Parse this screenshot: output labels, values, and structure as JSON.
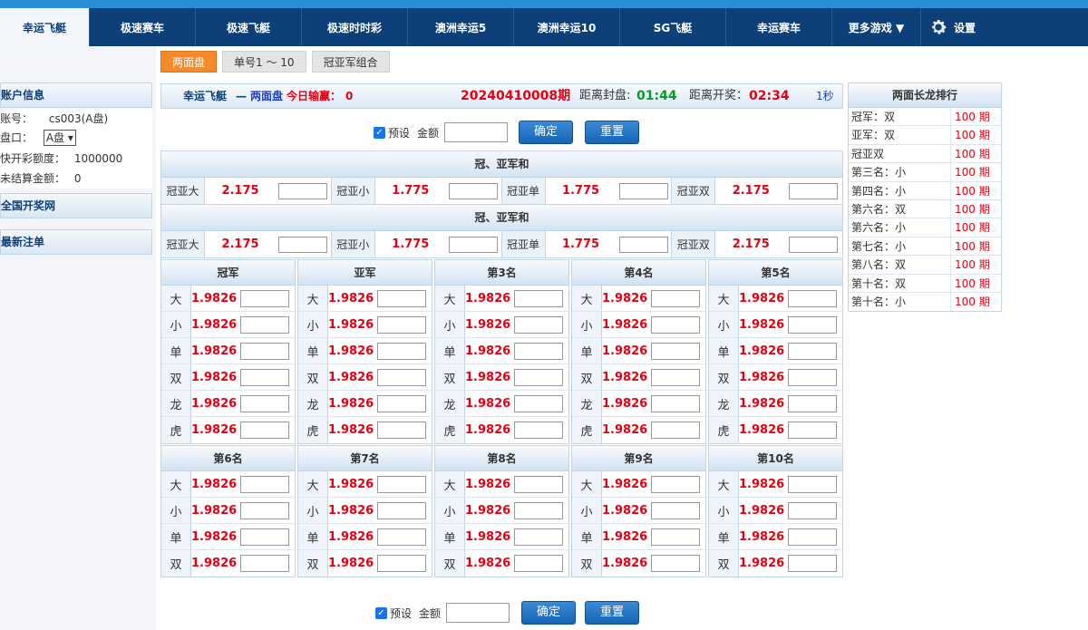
{
  "nav": {
    "items": [
      "幸运飞艇",
      "极速赛车",
      "极速飞艇",
      "极速时时彩",
      "澳洲幸运5",
      "澳洲幸运10",
      "SG飞艇",
      "幸运赛车"
    ],
    "more": "更多游戏 ▼",
    "settings": "设置"
  },
  "left": {
    "account_title": "账户信息",
    "account_label": "账号：",
    "account_value": "cs003(A盘)",
    "handicap_label": "盘口：",
    "handicap_value": "A盘",
    "quota_label": "快开彩额度：",
    "quota_value": "1000000",
    "unsettled_label": "未结算金额：",
    "unsettled_value": "0",
    "national_link": "全国开奖网",
    "latest_bets": "最新注单"
  },
  "subtabs": [
    "两面盘",
    "单号1 ～ 10",
    "冠亚军组合"
  ],
  "info": {
    "game": "幸运飞艇",
    "dash": "—",
    "mode": "两面盘",
    "today_label": "今日输赢：",
    "today_value": "0",
    "period": "20240410008期",
    "close_label": "距离封盘:",
    "close_time": "01:44",
    "draw_label": "距离开奖：",
    "draw_time": "02:34",
    "refresh": "1秒"
  },
  "preset": {
    "check": "✓",
    "label": "预设",
    "amount_label": "金额",
    "confirm": "确定",
    "reset": "重置"
  },
  "sum_sections": [
    {
      "title": "冠、亚军和",
      "cells": [
        {
          "label": "冠亚大",
          "odds": "2.175"
        },
        {
          "label": "冠亚小",
          "odds": "1.775"
        },
        {
          "label": "冠亚单",
          "odds": "1.775"
        },
        {
          "label": "冠亚双",
          "odds": "2.175"
        }
      ]
    },
    {
      "title": "冠、亚军和",
      "cells": [
        {
          "label": "冠亚大",
          "odds": "2.175"
        },
        {
          "label": "冠亚小",
          "odds": "1.775"
        },
        {
          "label": "冠亚单",
          "odds": "1.775"
        },
        {
          "label": "冠亚双",
          "odds": "2.175"
        }
      ]
    }
  ],
  "positions_top": [
    {
      "title": "冠军",
      "rows": [
        {
          "l": "大",
          "o": "1.9826"
        },
        {
          "l": "小",
          "o": "1.9826"
        },
        {
          "l": "单",
          "o": "1.9826"
        },
        {
          "l": "双",
          "o": "1.9826"
        },
        {
          "l": "龙",
          "o": "1.9826"
        },
        {
          "l": "虎",
          "o": "1.9826"
        }
      ]
    },
    {
      "title": "亚军",
      "rows": [
        {
          "l": "大",
          "o": "1.9826"
        },
        {
          "l": "小",
          "o": "1.9826"
        },
        {
          "l": "单",
          "o": "1.9826"
        },
        {
          "l": "双",
          "o": "1.9826"
        },
        {
          "l": "龙",
          "o": "1.9826"
        },
        {
          "l": "虎",
          "o": "1.9826"
        }
      ]
    },
    {
      "title": "第3名",
      "rows": [
        {
          "l": "大",
          "o": "1.9826"
        },
        {
          "l": "小",
          "o": "1.9826"
        },
        {
          "l": "单",
          "o": "1.9826"
        },
        {
          "l": "双",
          "o": "1.9826"
        },
        {
          "l": "龙",
          "o": "1.9826"
        },
        {
          "l": "虎",
          "o": "1.9826"
        }
      ]
    },
    {
      "title": "第4名",
      "rows": [
        {
          "l": "大",
          "o": "1.9826"
        },
        {
          "l": "小",
          "o": "1.9826"
        },
        {
          "l": "单",
          "o": "1.9826"
        },
        {
          "l": "双",
          "o": "1.9826"
        },
        {
          "l": "龙",
          "o": "1.9826"
        },
        {
          "l": "虎",
          "o": "1.9826"
        }
      ]
    },
    {
      "title": "第5名",
      "rows": [
        {
          "l": "大",
          "o": "1.9826"
        },
        {
          "l": "小",
          "o": "1.9826"
        },
        {
          "l": "单",
          "o": "1.9826"
        },
        {
          "l": "双",
          "o": "1.9826"
        },
        {
          "l": "龙",
          "o": "1.9826"
        },
        {
          "l": "虎",
          "o": "1.9826"
        }
      ]
    }
  ],
  "positions_bottom": [
    {
      "title": "第6名",
      "rows": [
        {
          "l": "大",
          "o": "1.9826"
        },
        {
          "l": "小",
          "o": "1.9826"
        },
        {
          "l": "单",
          "o": "1.9826"
        },
        {
          "l": "双",
          "o": "1.9826"
        }
      ]
    },
    {
      "title": "第7名",
      "rows": [
        {
          "l": "大",
          "o": "1.9826"
        },
        {
          "l": "小",
          "o": "1.9826"
        },
        {
          "l": "单",
          "o": "1.9826"
        },
        {
          "l": "双",
          "o": "1.9826"
        }
      ]
    },
    {
      "title": "第8名",
      "rows": [
        {
          "l": "大",
          "o": "1.9826"
        },
        {
          "l": "小",
          "o": "1.9826"
        },
        {
          "l": "单",
          "o": "1.9826"
        },
        {
          "l": "双",
          "o": "1.9826"
        }
      ]
    },
    {
      "title": "第9名",
      "rows": [
        {
          "l": "大",
          "o": "1.9826"
        },
        {
          "l": "小",
          "o": "1.9826"
        },
        {
          "l": "单",
          "o": "1.9826"
        },
        {
          "l": "双",
          "o": "1.9826"
        }
      ]
    },
    {
      "title": "第10名",
      "rows": [
        {
          "l": "大",
          "o": "1.9826"
        },
        {
          "l": "小",
          "o": "1.9826"
        },
        {
          "l": "单",
          "o": "1.9826"
        },
        {
          "l": "双",
          "o": "1.9826"
        }
      ]
    }
  ],
  "dragon": {
    "title": "两面长龙排行",
    "rows": [
      {
        "name": "冠军：双",
        "value": "100  期"
      },
      {
        "name": "亚军：双",
        "value": "100  期"
      },
      {
        "name": "冠亚双",
        "value": "100  期"
      },
      {
        "name": "第三名：小",
        "value": "100  期"
      },
      {
        "name": "第四名：小",
        "value": "100  期"
      },
      {
        "name": "第六名：双",
        "value": "100  期"
      },
      {
        "name": "第六名：小",
        "value": "100  期"
      },
      {
        "name": "第七名：小",
        "value": "100  期"
      },
      {
        "name": "第八名：双",
        "value": "100  期"
      },
      {
        "name": "第十名：双",
        "value": "100  期"
      },
      {
        "name": "第十名：小",
        "value": "100  期"
      }
    ]
  },
  "colors": {
    "nav_bg": "#0d3f79",
    "accent_orange": "#f58a2c",
    "odds_red": "#e60012",
    "timer_green": "#0a9a2a",
    "link_blue": "#1a3fd6"
  }
}
